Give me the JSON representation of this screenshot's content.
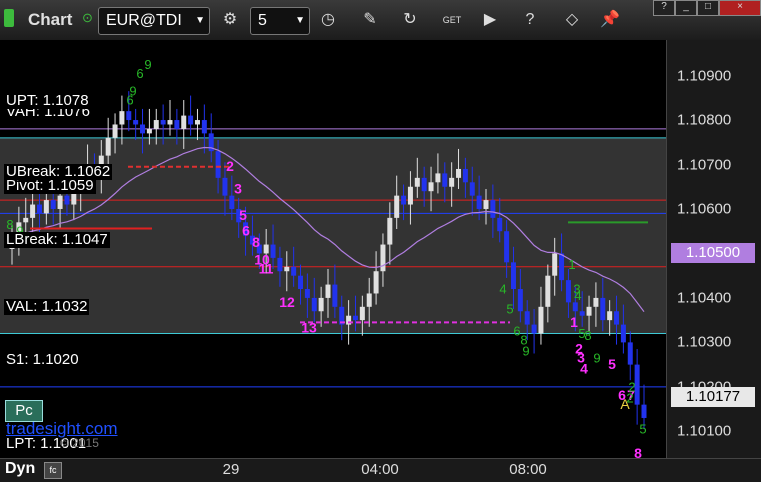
{
  "toolbar": {
    "title": "Chart",
    "symbol": "EUR@TDI",
    "interval": "5",
    "icons": [
      "gear-icon",
      "clock-icon",
      "pencil-icon",
      "refresh-icon",
      "get-icon",
      "play-icon",
      "question-icon",
      "tag-icon",
      "pushpin-icon"
    ]
  },
  "window_buttons": [
    "?",
    "_",
    "□",
    "×"
  ],
  "price_axis": {
    "ticks": [
      "1.10900",
      "1.10800",
      "1.10700",
      "1.10600",
      "1.10500",
      "1.10400",
      "1.10300",
      "1.10200",
      "1.10100"
    ],
    "current_price": "1.10177",
    "ma_price": "1.10500"
  },
  "time_axis": {
    "labels": [
      "29",
      "04:00",
      "08:00"
    ]
  },
  "levels": {
    "upt": "UPT: 1.1078",
    "vah": "VAH: 1.1076",
    "ubreak": "UBreak: 1.1062",
    "pivot": "Pivot: 1.1059",
    "lbreak": "LBreak: 1.1047",
    "val": "VAL: 1.1032",
    "s1": "S1: 1.1020",
    "lpt": "LPT: 1.1001"
  },
  "branding": {
    "site": "tradesight.com",
    "copyright": "© 2015",
    "pc_button": "Pc",
    "dyn_label": "Dyn"
  },
  "counts": {
    "magenta": [
      "2",
      "3",
      "5",
      "6",
      "8",
      "10",
      "11",
      "12",
      "13",
      "1",
      "2",
      "3",
      "4",
      "5",
      "6",
      "7",
      "8"
    ],
    "green": [
      "9",
      "6",
      "9",
      "6",
      "8",
      "9",
      "4",
      "5",
      "6",
      "8",
      "9",
      "2",
      "3",
      "4",
      "5",
      "1",
      "8",
      "9",
      "2",
      "5"
    ],
    "annotation_a": "A"
  },
  "colors": {
    "upt": "#b07ee0",
    "vah": "#3ec9d6",
    "ubreak": "#e02020",
    "pivot": "#2040ff",
    "lbreak": "#e02020",
    "val": "#3ec9d6",
    "s1": "#2040ff",
    "ma": "#b07ee0",
    "magenta": "#ff30ff",
    "green": "#28b828"
  },
  "chart_data": {
    "type": "candlestick",
    "ylim": [
      1.1004,
      1.1098
    ],
    "yticks": [
      1.109,
      1.108,
      1.107,
      1.106,
      1.105,
      1.104,
      1.103,
      1.102,
      1.101
    ],
    "reference_lines": [
      {
        "name": "UPT",
        "value": 1.1078
      },
      {
        "name": "VAH",
        "value": 1.1076
      },
      {
        "name": "UBreak",
        "value": 1.1062
      },
      {
        "name": "Pivot",
        "value": 1.1059
      },
      {
        "name": "LBreak",
        "value": 1.1047
      },
      {
        "name": "VAL",
        "value": 1.1032
      },
      {
        "name": "S1",
        "value": 1.102
      },
      {
        "name": "LPT",
        "value": 1.1001
      }
    ],
    "current_price": 1.10177,
    "moving_average_last": 1.105,
    "closes": [
      1.1054,
      1.1057,
      1.1058,
      1.1061,
      1.1059,
      1.1062,
      1.106,
      1.1063,
      1.1061,
      1.1064,
      1.1066,
      1.107,
      1.1068,
      1.1072,
      1.1076,
      1.1079,
      1.1082,
      1.108,
      1.1079,
      1.1077,
      1.1078,
      1.108,
      1.1079,
      1.108,
      1.1078,
      1.1081,
      1.1079,
      1.108,
      1.1077,
      1.1073,
      1.1067,
      1.1063,
      1.106,
      1.1057,
      1.1054,
      1.1052,
      1.105,
      1.1052,
      1.1049,
      1.1046,
      1.1047,
      1.1045,
      1.1042,
      1.104,
      1.1037,
      1.104,
      1.1043,
      1.1038,
      1.1034,
      1.1036,
      1.1035,
      1.1038,
      1.1041,
      1.1046,
      1.1052,
      1.1058,
      1.1063,
      1.1061,
      1.1065,
      1.1067,
      1.1064,
      1.1066,
      1.1068,
      1.1065,
      1.1067,
      1.1069,
      1.1066,
      1.1063,
      1.106,
      1.1062,
      1.1058,
      1.1055,
      1.1048,
      1.1042,
      1.1037,
      1.1034,
      1.1032,
      1.1038,
      1.1045,
      1.105,
      1.1044,
      1.1039,
      1.1037,
      1.1036,
      1.1038,
      1.104,
      1.1035,
      1.1037,
      1.1034,
      1.103,
      1.1025,
      1.1016,
      1.1013
    ]
  }
}
